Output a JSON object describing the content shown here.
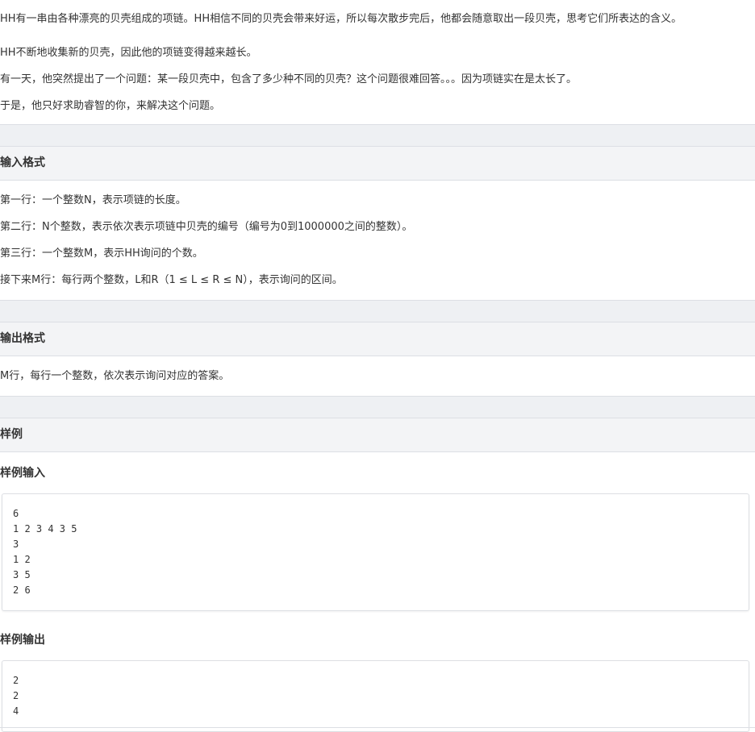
{
  "description": {
    "paragraphs": [
      "HH有一串由各种漂亮的贝壳组成的项链。HH相信不同的贝壳会带来好运，所以每次散步完后，他都会随意取出一段贝壳，思考它们所表达的含义。",
      "HH不断地收集新的贝壳，因此他的项链变得越来越长。",
      "有一天，他突然提出了一个问题：某一段贝壳中，包含了多少种不同的贝壳？这个问题很难回答。。。因为项链实在是太长了。",
      "于是，他只好求助睿智的你，来解决这个问题。"
    ]
  },
  "input_format": {
    "title": "输入格式",
    "lines": [
      "第一行：一个整数N，表示项链的长度。",
      "第二行：N个整数，表示依次表示项链中贝壳的编号（编号为0到1000000之间的整数）。",
      "第三行：一个整数M，表示HH询问的个数。",
      "接下来M行：每行两个整数，L和R（1 ≤ L ≤ R ≤ N），表示询问的区间。"
    ]
  },
  "output_format": {
    "title": "输出格式",
    "lines": [
      "M行，每行一个整数，依次表示询问对应的答案。"
    ]
  },
  "sample": {
    "title": "样例",
    "input_title": "样例输入",
    "input_text": "6\n1 2 3 4 3 5\n3\n1 2\n3 5\n2 6",
    "output_title": "样例输出",
    "output_text": "2\n2\n4"
  }
}
